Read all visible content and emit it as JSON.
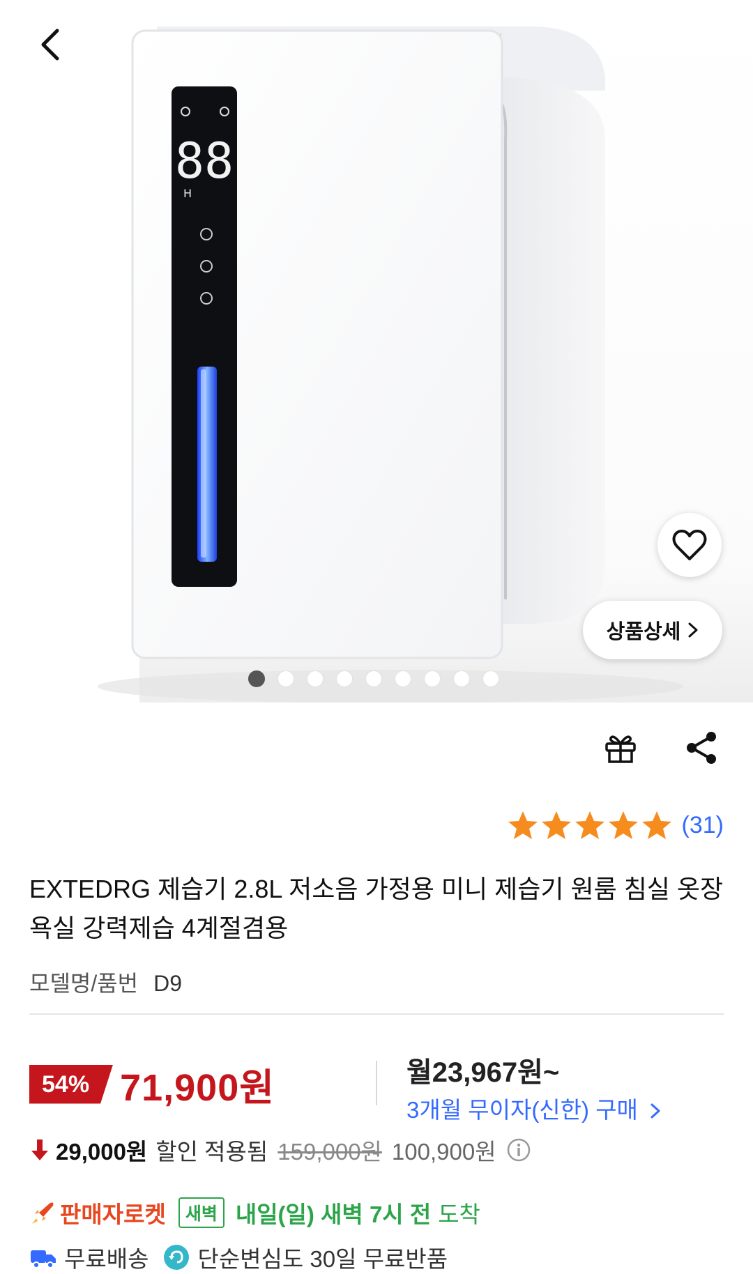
{
  "product_image": {
    "alt": "EXTEDRG 제습기",
    "display_reading": "88",
    "display_mode": "H"
  },
  "nav": {
    "back_icon": "chevron-left-icon"
  },
  "gallery": {
    "total": 9,
    "active_index": 0
  },
  "overlay": {
    "wishlist_icon": "heart-outline-icon",
    "detail_button_label": "상품상세",
    "detail_button_icon": "chevron-right-icon"
  },
  "actions": {
    "gift_icon": "gift-icon",
    "share_icon": "share-icon"
  },
  "rating": {
    "stars": 5,
    "count_label": "(31)",
    "star_color": "#f68b1e"
  },
  "product": {
    "title": "EXTEDRG 제습기 2.8L 저소음 가정용 미니 제습기 원룸 침실 옷장 욕실 강력제습 4계절겸용",
    "model_label": "모델명/품번",
    "model_value": "D9"
  },
  "price": {
    "discount_badge": "54%",
    "sale_price": "71,900원",
    "monthly_price": "월23,967원~",
    "installment_link": "3개월 무이자(신한) 구매",
    "coupon_amount": "29,000원",
    "coupon_text": "할인 적용됨",
    "original_price": "159,000원",
    "pre_coupon_price": "100,900원",
    "accent_color": "#c4161c",
    "link_color": "#346aff"
  },
  "delivery": {
    "rocket_label": "판매자로켓",
    "dawn_tag": "새벽",
    "arrival_bold": "내일(일) 새벽 7시 전",
    "arrival_suffix": "도착",
    "free_shipping": "무료배송",
    "return_policy": "단순변심도 30일 무료반품",
    "accent_color": "#2ca44a"
  }
}
